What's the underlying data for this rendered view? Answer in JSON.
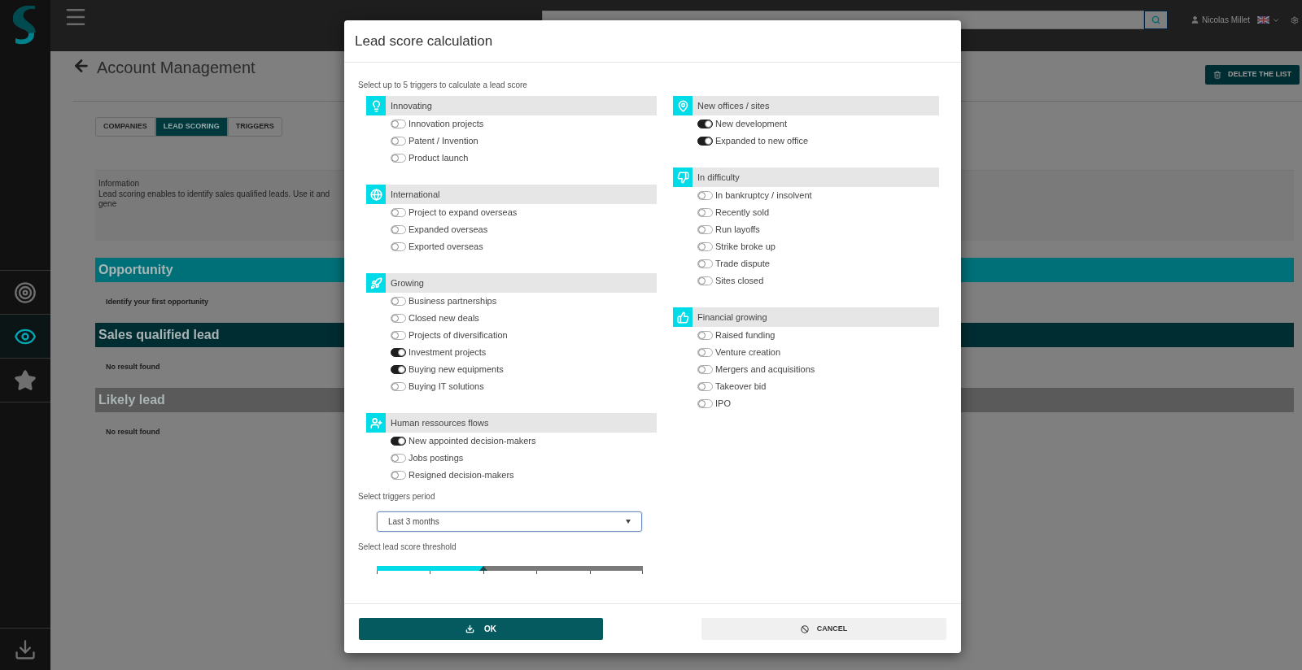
{
  "sidebar": {
    "items": [
      {
        "kind": "target",
        "selected": false
      },
      {
        "kind": "eye",
        "selected": true
      },
      {
        "kind": "star",
        "selected": false
      }
    ]
  },
  "topbar": {
    "user": "Nicolas Millet"
  },
  "page": {
    "title": "Account Management",
    "delete_button": "DELETE THE LIST",
    "tabs": [
      {
        "label": "COMPANIES",
        "selected": false
      },
      {
        "label": "LEAD SCORING",
        "selected": true
      },
      {
        "label": "TRIGGERS",
        "selected": false
      }
    ],
    "info": {
      "title": "Information",
      "text": "Lead scoring enables to identify sales qualified leads. Use it and gene"
    },
    "sections": [
      {
        "title": "Opportunity",
        "color": "#007078",
        "message": "Identify your first opportunity"
      },
      {
        "title": "Sales qualified lead",
        "color": "#002d32",
        "message": "No result found"
      },
      {
        "title": "Likely lead",
        "color": "#5a5a5a",
        "message": "No result found"
      }
    ]
  },
  "modal": {
    "title": "Lead score calculation",
    "intro": "Select up to 5 triggers to calculate a lead score",
    "columns": [
      [
        {
          "kind": "bulb",
          "title": "Innovating",
          "triggers": [
            {
              "label": "Innovation projects",
              "on": false
            },
            {
              "label": "Patent / Invention",
              "on": false
            },
            {
              "label": "Product launch",
              "on": false
            }
          ]
        },
        {
          "kind": "globe",
          "title": "International",
          "triggers": [
            {
              "label": "Project to expand overseas",
              "on": false
            },
            {
              "label": "Expanded overseas",
              "on": false
            },
            {
              "label": "Exported overseas",
              "on": false
            }
          ]
        },
        {
          "kind": "rocket",
          "title": "Growing",
          "triggers": [
            {
              "label": "Business partnerships",
              "on": false
            },
            {
              "label": "Closed new deals",
              "on": false
            },
            {
              "label": "Projects of diversification",
              "on": false
            },
            {
              "label": "Investment projects",
              "on": true
            },
            {
              "label": "Buying new equipments",
              "on": true
            },
            {
              "label": "Buying IT solutions",
              "on": false
            }
          ]
        },
        {
          "kind": "user-plus",
          "title": "Human ressources flows",
          "triggers": [
            {
              "label": "New appointed decision-makers",
              "on": true
            },
            {
              "label": "Jobs postings",
              "on": false
            },
            {
              "label": "Resigned decision-makers",
              "on": false
            }
          ]
        }
      ],
      [
        {
          "kind": "pin",
          "title": "New offices / sites",
          "triggers": [
            {
              "label": "New development",
              "on": true
            },
            {
              "label": "Expanded to new office",
              "on": true
            }
          ]
        },
        {
          "kind": "thumbs-down",
          "title": "In difficulty",
          "triggers": [
            {
              "label": "In bankruptcy / insolvent",
              "on": false
            },
            {
              "label": "Recently sold",
              "on": false
            },
            {
              "label": "Run layoffs",
              "on": false
            },
            {
              "label": "Strike broke up",
              "on": false
            },
            {
              "label": "Trade dispute",
              "on": false
            },
            {
              "label": "Sites closed",
              "on": false
            }
          ]
        },
        {
          "kind": "thumbs-up",
          "title": "Financial growing",
          "triggers": [
            {
              "label": "Raised funding",
              "on": false
            },
            {
              "label": "Venture creation",
              "on": false
            },
            {
              "label": "Mergers and acquisitions",
              "on": false
            },
            {
              "label": "Takeover bid",
              "on": false
            },
            {
              "label": "IPO",
              "on": false
            }
          ]
        }
      ]
    ],
    "period": {
      "label": "Select triggers period",
      "value": "Last 3 months"
    },
    "threshold": {
      "label": "Select lead score threshold",
      "level": 0.4
    },
    "ok": "OK",
    "cancel": "CANCEL"
  }
}
